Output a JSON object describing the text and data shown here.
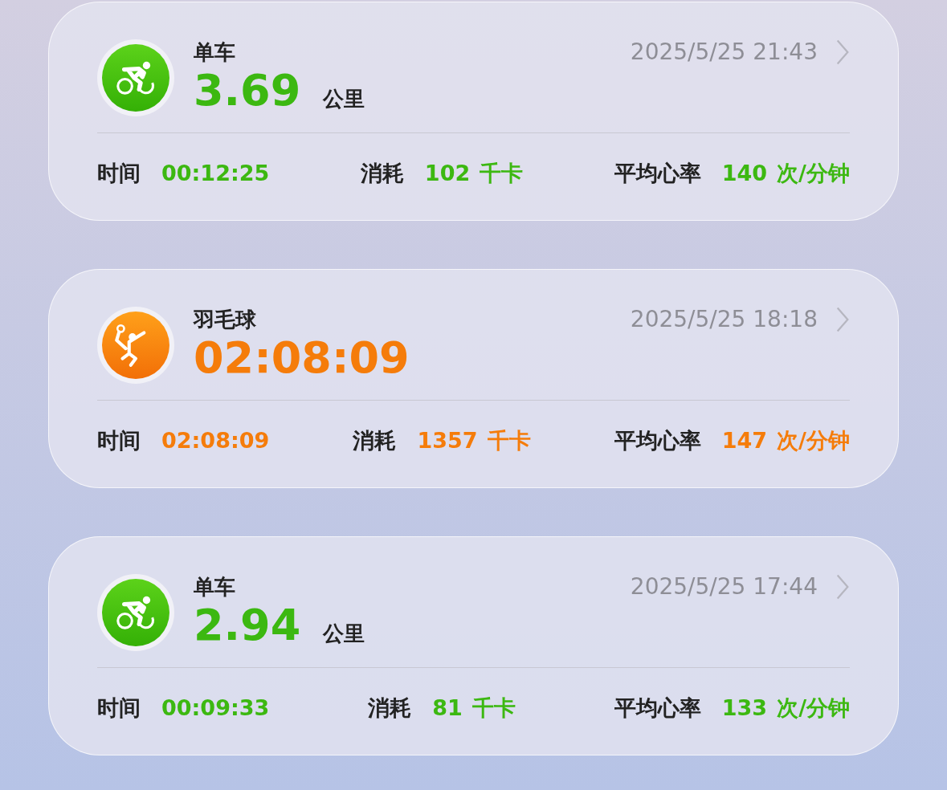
{
  "activities": [
    {
      "kind": "cycling",
      "color": "#3cb811",
      "title": "单车",
      "value": "3.69",
      "unit": "公里",
      "date": "2025/5/25 21:43",
      "stats": [
        {
          "label": "时间",
          "value": "00:12:25"
        },
        {
          "label": "消耗",
          "value": "102",
          "unit": "千卡"
        },
        {
          "label": "平均心率",
          "value": "140",
          "unit": "次/分钟"
        }
      ]
    },
    {
      "kind": "badminton",
      "color": "#f57c0a",
      "title": "羽毛球",
      "value": "02:08:09",
      "date": "2025/5/25 18:18",
      "stats": [
        {
          "label": "时间",
          "value": "02:08:09"
        },
        {
          "label": "消耗",
          "value": "1357",
          "unit": "千卡"
        },
        {
          "label": "平均心率",
          "value": "147",
          "unit": "次/分钟"
        }
      ]
    },
    {
      "kind": "cycling",
      "color": "#3cb811",
      "title": "单车",
      "value": "2.94",
      "unit": "公里",
      "date": "2025/5/25 17:44",
      "stats": [
        {
          "label": "时间",
          "value": "00:09:33"
        },
        {
          "label": "消耗",
          "value": "81",
          "unit": "千卡"
        },
        {
          "label": "平均心率",
          "value": "133",
          "unit": "次/分钟"
        }
      ]
    }
  ]
}
